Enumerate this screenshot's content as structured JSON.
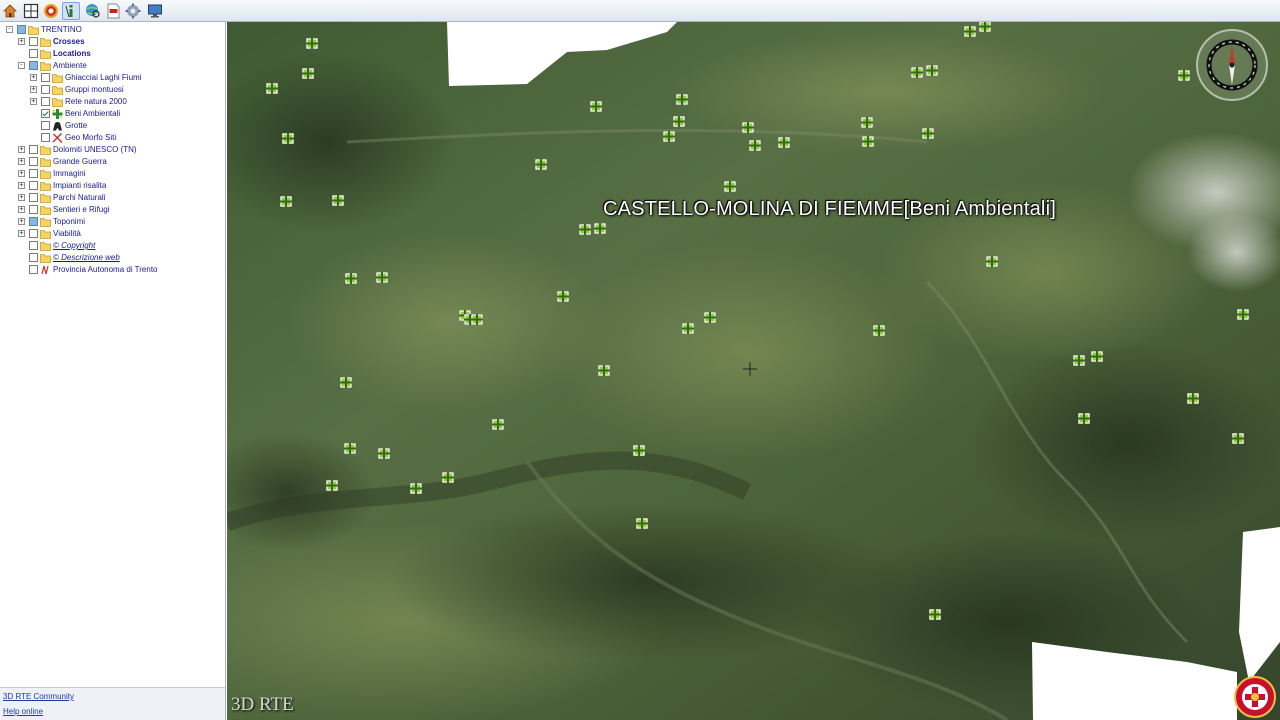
{
  "toolbar": {
    "buttons": [
      {
        "name": "home-icon"
      },
      {
        "name": "grid-view-icon"
      },
      {
        "name": "target-icon"
      },
      {
        "name": "info-cursor-icon"
      },
      {
        "name": "globe-search-icon"
      },
      {
        "name": "pdf-export-icon"
      },
      {
        "name": "settings-icon"
      },
      {
        "name": "screen-icon"
      }
    ],
    "active_index": 3
  },
  "tree": {
    "items": [
      {
        "label": "TRENTINO",
        "level": 0,
        "expander": "-",
        "check": "partial",
        "icon": "folder",
        "style": "normal"
      },
      {
        "label": "Crosses",
        "level": 1,
        "expander": "+",
        "check": "none",
        "icon": "folder",
        "style": "bold"
      },
      {
        "label": "Locations",
        "level": 1,
        "expander": "",
        "check": "none",
        "icon": "folder",
        "style": "bold"
      },
      {
        "label": "Ambiente",
        "level": 1,
        "expander": "-",
        "check": "partial",
        "icon": "folder",
        "style": "normal"
      },
      {
        "label": "Ghiacciai Laghi Fiumi",
        "level": 2,
        "expander": "+",
        "check": "none",
        "icon": "folder",
        "style": "normal"
      },
      {
        "label": "Gruppi montuosi",
        "level": 2,
        "expander": "+",
        "check": "none",
        "icon": "folder",
        "style": "normal"
      },
      {
        "label": "Rete natura 2000",
        "level": 2,
        "expander": "+",
        "check": "none",
        "icon": "folder",
        "style": "normal"
      },
      {
        "label": "Beni Ambientali",
        "level": 2,
        "expander": "",
        "check": "checked",
        "icon": "beni",
        "style": "normal"
      },
      {
        "label": "Grotte",
        "level": 2,
        "expander": "",
        "check": "none",
        "icon": "grotte",
        "style": "normal"
      },
      {
        "label": "Geo Morfo Siti",
        "level": 2,
        "expander": "",
        "check": "none",
        "icon": "geomorfo",
        "style": "normal"
      },
      {
        "label": "Dolomiti UNESCO (TN)",
        "level": 1,
        "expander": "+",
        "check": "none",
        "icon": "folder",
        "style": "normal"
      },
      {
        "label": "Grande Guerra",
        "level": 1,
        "expander": "+",
        "check": "none",
        "icon": "folder",
        "style": "normal"
      },
      {
        "label": "Immagini",
        "level": 1,
        "expander": "+",
        "check": "none",
        "icon": "folder",
        "style": "normal"
      },
      {
        "label": "Impianti risalita",
        "level": 1,
        "expander": "+",
        "check": "none",
        "icon": "folder",
        "style": "normal"
      },
      {
        "label": "Parchi Naturali",
        "level": 1,
        "expander": "+",
        "check": "none",
        "icon": "folder",
        "style": "normal"
      },
      {
        "label": "Sentieri e Rifugi",
        "level": 1,
        "expander": "+",
        "check": "none",
        "icon": "folder",
        "style": "normal"
      },
      {
        "label": "Toponimi",
        "level": 1,
        "expander": "+",
        "check": "partial",
        "icon": "folder",
        "style": "normal"
      },
      {
        "label": "Viabilità",
        "level": 1,
        "expander": "+",
        "check": "none",
        "icon": "folder",
        "style": "normal"
      },
      {
        "label": "© Copyright",
        "level": 1,
        "expander": "",
        "check": "none",
        "icon": "folder",
        "style": "link"
      },
      {
        "label": "© Descrizione web",
        "level": 1,
        "expander": "",
        "check": "none",
        "icon": "folder",
        "style": "link"
      },
      {
        "label": "Provincia Autonoma di Trento",
        "level": 1,
        "expander": "",
        "check": "none",
        "icon": "pat",
        "style": "normal"
      }
    ]
  },
  "footer": {
    "community_link": "3D RTE Community",
    "help_link": "Help online"
  },
  "map": {
    "label": "CASTELLO-MOLINA DI FIEMME[Beni Ambientali]",
    "watermark": "3D RTE"
  },
  "colors": {
    "toolbar_bg": "#e6ecf3",
    "tree_text": "#1a1a9c",
    "marker_green": "#c8e64a",
    "link": "#1f3ca6"
  }
}
